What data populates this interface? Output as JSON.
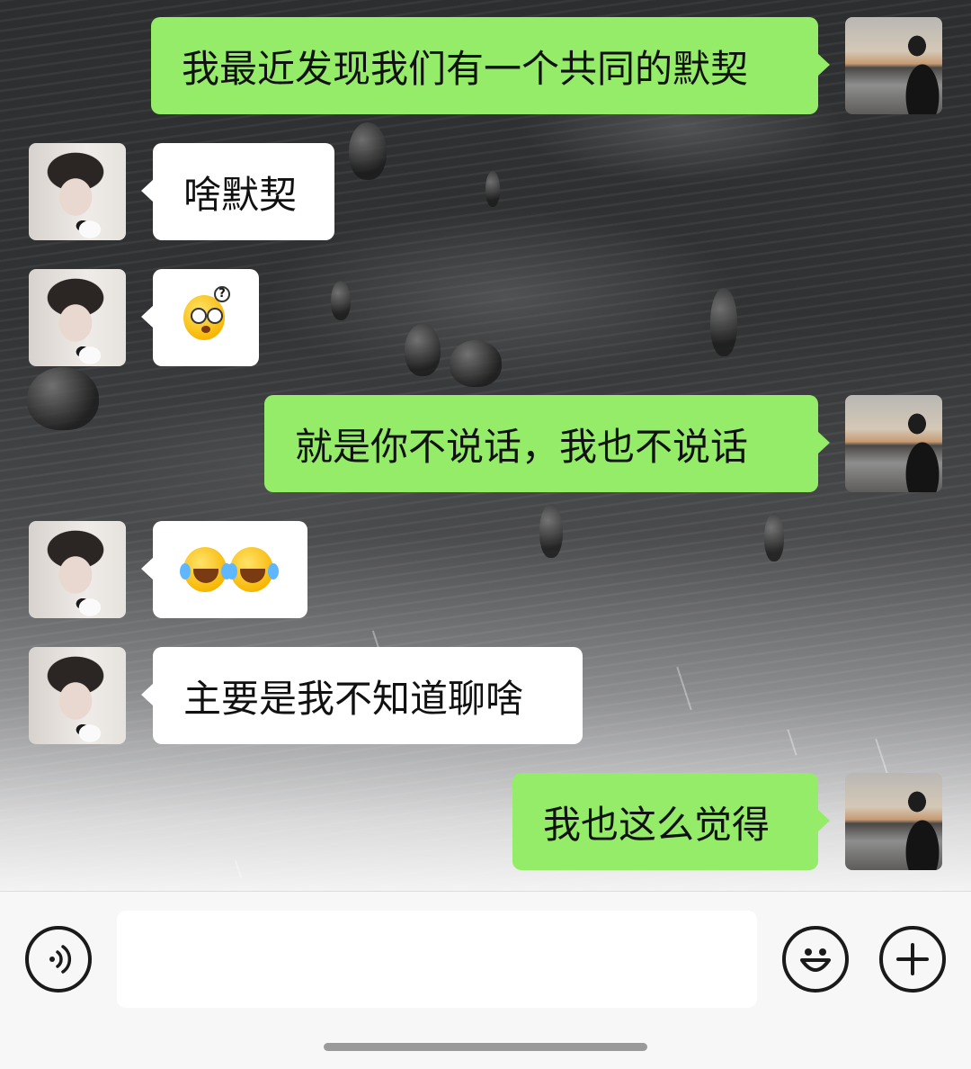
{
  "messages": [
    {
      "side": "out",
      "text": "我最近发现我们有一个共同的默契"
    },
    {
      "side": "in",
      "text": "啥默契"
    },
    {
      "side": "in",
      "emoji": [
        "puzzled-face"
      ]
    },
    {
      "side": "out",
      "text": "就是你不说话，我也不说话"
    },
    {
      "side": "in",
      "emoji": [
        "tears-of-joy",
        "tears-of-joy"
      ]
    },
    {
      "side": "in",
      "text": "主要是我不知道聊啥"
    },
    {
      "side": "out",
      "text": "我也这么觉得"
    }
  ],
  "input_bar": {
    "voice_icon": "voice-wave-icon",
    "text_value": "",
    "emoji_icon": "smiley-icon",
    "more_icon": "plus-icon"
  },
  "colors": {
    "outgoing_bubble": "#95ec69",
    "incoming_bubble": "#ffffff",
    "input_bar_bg": "#f7f7f7"
  }
}
